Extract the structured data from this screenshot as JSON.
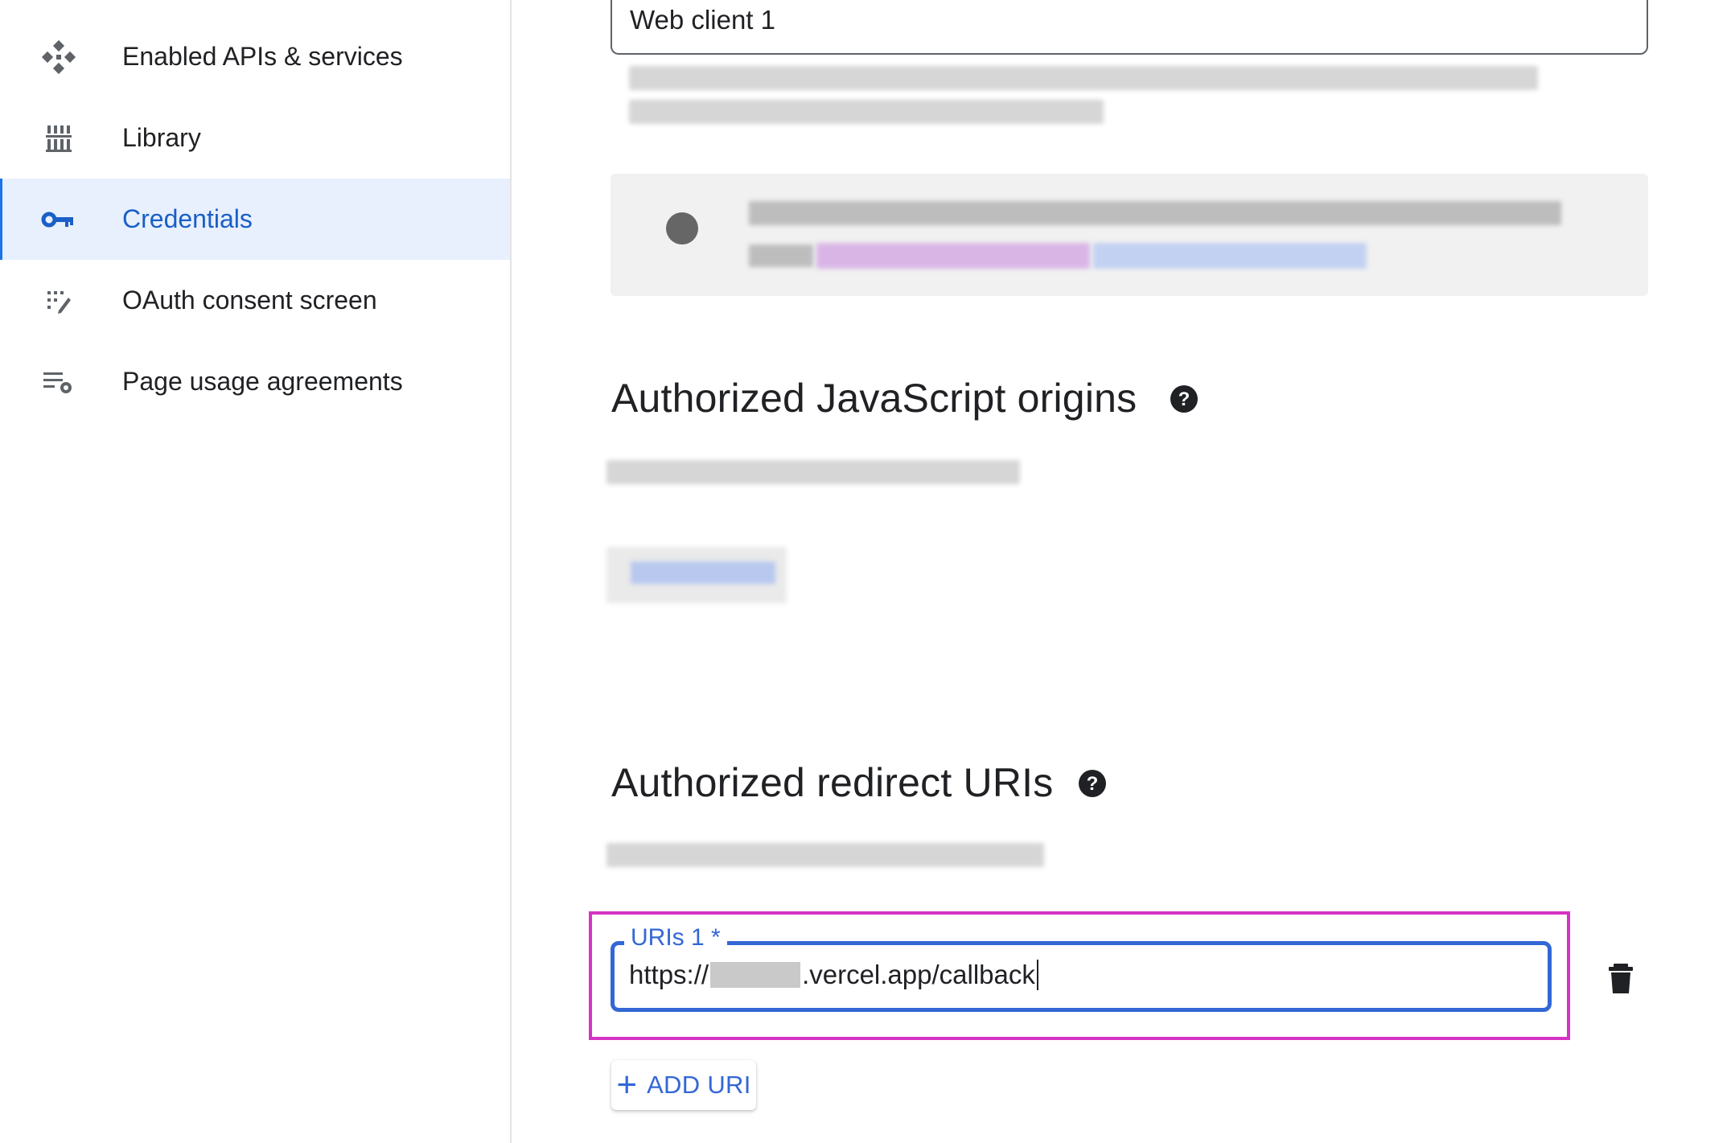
{
  "sidebar": {
    "items": [
      {
        "label": "Enabled APIs & services",
        "icon": "api-services-icon",
        "active": false
      },
      {
        "label": "Library",
        "icon": "library-icon",
        "active": false
      },
      {
        "label": "Credentials",
        "icon": "key-icon",
        "active": true
      },
      {
        "label": "OAuth consent screen",
        "icon": "oauth-consent-icon",
        "active": false
      },
      {
        "label": "Page usage agreements",
        "icon": "settings-list-icon",
        "active": false
      }
    ]
  },
  "client": {
    "name_value": "Web client 1"
  },
  "origins": {
    "title": "Authorized JavaScript origins",
    "help_icon": "help-icon"
  },
  "redirects": {
    "title": "Authorized redirect URIs",
    "help_icon": "help-icon",
    "uri_label": "URIs 1 *",
    "uri_prefix": "https://",
    "uri_suffix": ".vercel.app/callback",
    "delete_icon": "trash-icon",
    "add_label": "ADD URI"
  },
  "colors": {
    "accent": "#3367d6",
    "active_nav_bg": "#e8f0fe",
    "highlight": "#d633c4"
  }
}
